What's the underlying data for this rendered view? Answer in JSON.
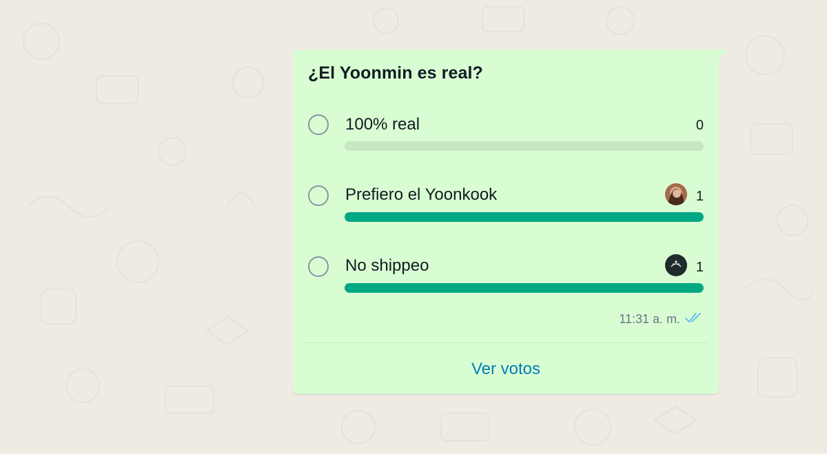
{
  "poll": {
    "question": "¿El Yoonmin es real?",
    "options": [
      {
        "label": "100% real",
        "count": "0",
        "fraction": 0,
        "has_avatar": false
      },
      {
        "label": "Prefiero el Yoonkook",
        "count": "1",
        "fraction": 1,
        "has_avatar": true
      },
      {
        "label": "No shippeo",
        "count": "1",
        "fraction": 1,
        "has_avatar": true
      }
    ],
    "time": "11:31 a. m.",
    "view_votes_label": "Ver votos"
  },
  "icons": {
    "read_receipt": "double-check-icon",
    "radio": "radio-unchecked-icon"
  },
  "colors": {
    "bubble": "#d9fdd3",
    "bar_fill": "#00a884",
    "bar_track": "#c6e7c1",
    "link": "#027eb5",
    "read_check": "#53bdeb",
    "chat_background": "#efeae2"
  }
}
